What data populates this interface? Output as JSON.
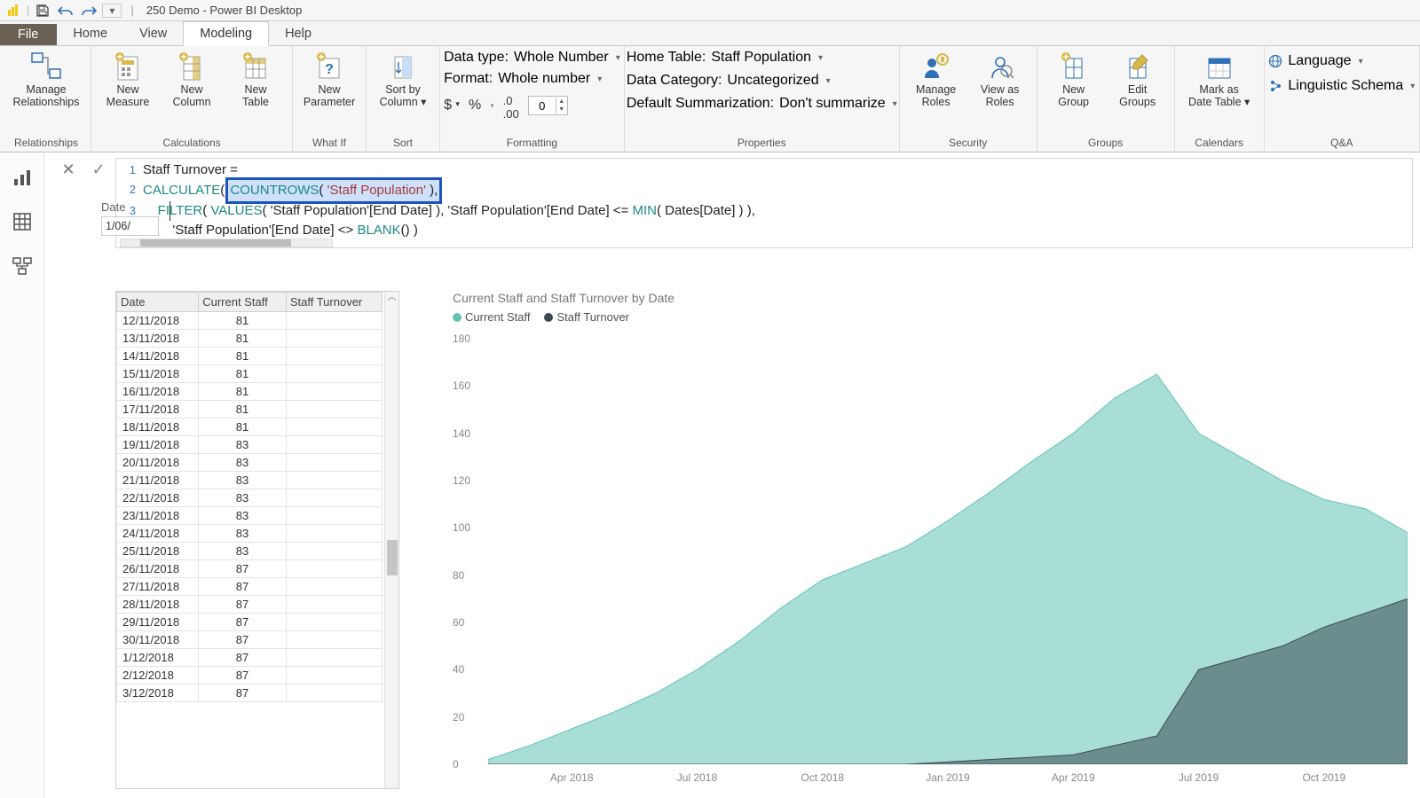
{
  "title": {
    "document": "250 Demo",
    "app": "Power BI Desktop"
  },
  "tabs": {
    "file": "File",
    "home": "Home",
    "view": "View",
    "modeling": "Modeling",
    "help": "Help",
    "active": "Modeling"
  },
  "ribbon": {
    "relationships": {
      "manage": "Manage\nRelationships",
      "group": "Relationships"
    },
    "calculations": {
      "measure": "New\nMeasure",
      "column": "New\nColumn",
      "table": "New\nTable",
      "group": "Calculations"
    },
    "whatif": {
      "parameter": "New\nParameter",
      "group": "What If"
    },
    "sort": {
      "sortby": "Sort by\nColumn ▾",
      "group": "Sort"
    },
    "formatting": {
      "datatype_label": "Data type:",
      "datatype_value": "Whole Number",
      "format_label": "Format:",
      "format_value": "Whole number",
      "decimals": "0",
      "group": "Formatting"
    },
    "properties": {
      "hometable_label": "Home Table:",
      "hometable_value": "Staff Population",
      "category_label": "Data Category:",
      "category_value": "Uncategorized",
      "summarize_label": "Default Summarization:",
      "summarize_value": "Don't summarize",
      "group": "Properties"
    },
    "security": {
      "manage": "Manage\nRoles",
      "view": "View as\nRoles",
      "group": "Security"
    },
    "groups": {
      "new": "New\nGroup",
      "edit": "Edit\nGroups",
      "group": "Groups"
    },
    "calendars": {
      "mark": "Mark as\nDate Table ▾",
      "group": "Calendars"
    },
    "qa": {
      "language": "Language",
      "schema": "Linguistic Schema",
      "group": "Q&A"
    }
  },
  "formula": {
    "l1": "Staff Turnover =",
    "l2_pre": "CALCULATE",
    "l2_hl": "COUNTROWS( 'Staff Population' ),",
    "l3_indent": "    ",
    "l3_filter": "FILTER",
    "l3_values": "VALUES",
    "l3_rest1": "( 'Staff Population'[End Date] ), 'Staff Population'[End Date] <= ",
    "l3_min": "MIN",
    "l3_rest2": "( Dates[Date] ) ),",
    "l4_indent": "        ",
    "l4_pre": "'Staff Population'[End Date] <> ",
    "l4_blank": "BLANK",
    "l4_post": "() )"
  },
  "date_filter": {
    "label": "Date",
    "value": "1/06/"
  },
  "table": {
    "columns": [
      "Date",
      "Current Staff",
      "Staff Turnover"
    ],
    "rows": [
      {
        "d": "12/11/2018",
        "c": "81",
        "t": ""
      },
      {
        "d": "13/11/2018",
        "c": "81",
        "t": ""
      },
      {
        "d": "14/11/2018",
        "c": "81",
        "t": ""
      },
      {
        "d": "15/11/2018",
        "c": "81",
        "t": ""
      },
      {
        "d": "16/11/2018",
        "c": "81",
        "t": ""
      },
      {
        "d": "17/11/2018",
        "c": "81",
        "t": ""
      },
      {
        "d": "18/11/2018",
        "c": "81",
        "t": ""
      },
      {
        "d": "19/11/2018",
        "c": "83",
        "t": ""
      },
      {
        "d": "20/11/2018",
        "c": "83",
        "t": ""
      },
      {
        "d": "21/11/2018",
        "c": "83",
        "t": ""
      },
      {
        "d": "22/11/2018",
        "c": "83",
        "t": ""
      },
      {
        "d": "23/11/2018",
        "c": "83",
        "t": ""
      },
      {
        "d": "24/11/2018",
        "c": "83",
        "t": ""
      },
      {
        "d": "25/11/2018",
        "c": "83",
        "t": ""
      },
      {
        "d": "26/11/2018",
        "c": "87",
        "t": ""
      },
      {
        "d": "27/11/2018",
        "c": "87",
        "t": ""
      },
      {
        "d": "28/11/2018",
        "c": "87",
        "t": ""
      },
      {
        "d": "29/11/2018",
        "c": "87",
        "t": ""
      },
      {
        "d": "30/11/2018",
        "c": "87",
        "t": ""
      },
      {
        "d": "1/12/2018",
        "c": "87",
        "t": ""
      },
      {
        "d": "2/12/2018",
        "c": "87",
        "t": ""
      },
      {
        "d": "3/12/2018",
        "c": "87",
        "t": ""
      }
    ]
  },
  "chart": {
    "title": "Current Staff and Staff Turnover by Date",
    "legend": {
      "s1": "Current Staff",
      "s2": "Staff Turnover"
    },
    "yticks": [
      "180",
      "160",
      "140",
      "120",
      "100",
      "80",
      "60",
      "40",
      "20",
      "0"
    ],
    "xticks": [
      "Apr 2018",
      "Jul 2018",
      "Oct 2018",
      "Jan 2019",
      "Apr 2019",
      "Jul 2019",
      "Oct 2019"
    ]
  },
  "chart_data": {
    "type": "area",
    "xlabel": "",
    "ylabel": "",
    "ylim": [
      0,
      180
    ],
    "x_range": [
      "Feb 2018",
      "Dec 2019"
    ],
    "series": [
      {
        "name": "Current Staff",
        "color": "#62c3b5",
        "points": [
          {
            "x": "Feb 2018",
            "y": 2
          },
          {
            "x": "Mar 2018",
            "y": 8
          },
          {
            "x": "Apr 2018",
            "y": 15
          },
          {
            "x": "May 2018",
            "y": 22
          },
          {
            "x": "Jun 2018",
            "y": 30
          },
          {
            "x": "Jul 2018",
            "y": 40
          },
          {
            "x": "Aug 2018",
            "y": 52
          },
          {
            "x": "Sep 2018",
            "y": 66
          },
          {
            "x": "Oct 2018",
            "y": 78
          },
          {
            "x": "Nov 2018",
            "y": 85
          },
          {
            "x": "Dec 2018",
            "y": 92
          },
          {
            "x": "Jan 2019",
            "y": 103
          },
          {
            "x": "Feb 2019",
            "y": 115
          },
          {
            "x": "Mar 2019",
            "y": 128
          },
          {
            "x": "Apr 2019",
            "y": 140
          },
          {
            "x": "May 2019",
            "y": 155
          },
          {
            "x": "Jun 2019",
            "y": 165
          },
          {
            "x": "Jul 2019",
            "y": 140
          },
          {
            "x": "Aug 2019",
            "y": 130
          },
          {
            "x": "Sep 2019",
            "y": 120
          },
          {
            "x": "Oct 2019",
            "y": 112
          },
          {
            "x": "Nov 2019",
            "y": 108
          },
          {
            "x": "Dec 2019",
            "y": 98
          }
        ]
      },
      {
        "name": "Staff Turnover",
        "color": "#3b4b52",
        "points": [
          {
            "x": "Feb 2018",
            "y": 0
          },
          {
            "x": "Dec 2018",
            "y": 0
          },
          {
            "x": "Feb 2019",
            "y": 2
          },
          {
            "x": "Apr 2019",
            "y": 4
          },
          {
            "x": "May 2019",
            "y": 8
          },
          {
            "x": "Jun 2019",
            "y": 12
          },
          {
            "x": "Jul 2019",
            "y": 40
          },
          {
            "x": "Aug 2019",
            "y": 45
          },
          {
            "x": "Sep 2019",
            "y": 50
          },
          {
            "x": "Oct 2019",
            "y": 58
          },
          {
            "x": "Nov 2019",
            "y": 64
          },
          {
            "x": "Dec 2019",
            "y": 70
          }
        ]
      }
    ]
  }
}
